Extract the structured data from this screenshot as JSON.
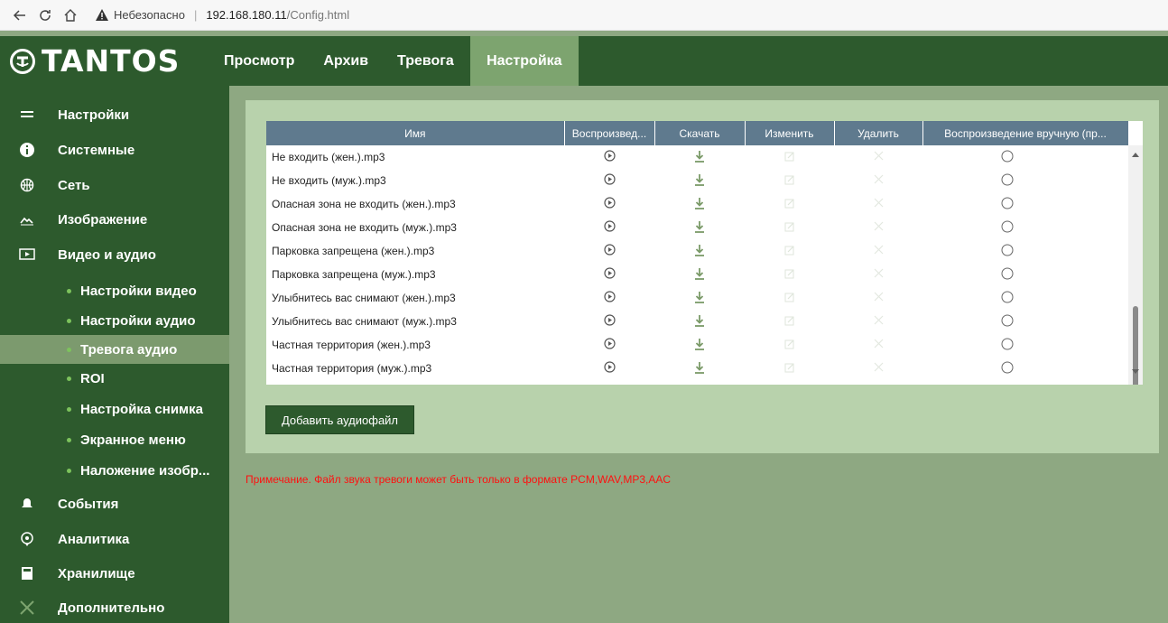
{
  "browser": {
    "warning": "Небезопасно",
    "host": "192.168.180.11",
    "path": "/Config.html"
  },
  "brand": {
    "name": "TANTOS"
  },
  "nav": {
    "tabs": [
      {
        "label": "Просмотр",
        "active": false
      },
      {
        "label": "Архив",
        "active": false
      },
      {
        "label": "Тревога",
        "active": false
      },
      {
        "label": "Настройка",
        "active": true
      }
    ]
  },
  "sidebar": {
    "items": [
      {
        "label": "Настройки",
        "icon": "list-icon"
      },
      {
        "label": "Системные",
        "icon": "info-icon"
      },
      {
        "label": "Сеть",
        "icon": "globe-icon"
      },
      {
        "label": "Изображение",
        "icon": "image-icon"
      },
      {
        "label": "Видео и аудио",
        "icon": "video-icon"
      }
    ],
    "subitems": [
      {
        "label": "Настройки видео",
        "active": false
      },
      {
        "label": "Настройки аудио",
        "active": false
      },
      {
        "label": "Тревога аудио",
        "active": true
      },
      {
        "label": "ROI",
        "active": false
      },
      {
        "label": "Настройка снимка",
        "active": false
      },
      {
        "label": "Экранное меню",
        "active": false
      },
      {
        "label": "Наложение изобр...",
        "active": false
      }
    ],
    "items2": [
      {
        "label": "События",
        "icon": "events-icon"
      },
      {
        "label": "Аналитика",
        "icon": "analytics-icon"
      },
      {
        "label": "Хранилище",
        "icon": "storage-icon"
      },
      {
        "label": "Дополнительно",
        "icon": "tools-icon"
      }
    ]
  },
  "table": {
    "headers": [
      "Имя",
      "Воспроизвед...",
      "Скачать",
      "Изменить",
      "Удалить",
      "Воспроизведение вручную (пр..."
    ],
    "rows": [
      "Не входить (жен.).mp3",
      "Не входить (муж.).mp3",
      "Опасная зона не входить (жен.).mp3",
      "Опасная зона не входить (муж.).mp3",
      "Парковка запрещена (жен.).mp3",
      "Парковка запрещена (муж.).mp3",
      "Улыбнитесь вас снимают (жен.).mp3",
      "Улыбнитесь вас снимают (муж.).mp3",
      "Частная территория (жен.).mp3",
      "Частная территория (муж.).mp3"
    ]
  },
  "add_button": "Добавить аудиофайл",
  "note": "Примечание. Файл звука тревоги может быть только в формате PCM,WAV,MP3,AAC",
  "colors": {
    "nav_bg": "#2d5a2d",
    "active_tab": "#7da46f",
    "panel": "#b8d2ac",
    "header": "#5f7a8e",
    "note": "#ff1010"
  }
}
